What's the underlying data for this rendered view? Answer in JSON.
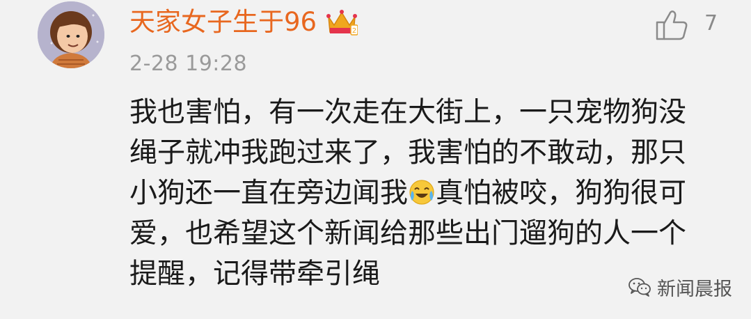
{
  "comment": {
    "username": "天家女子生于96",
    "timestamp": "2-28 19:28",
    "like_count": "7",
    "text_lines": [
      "我也害怕，有一次走在大街上，一只宠物狗没",
      "绳子就冲我跑过来了，我害怕的不敢动，那只",
      "小狗还一直在旁边闻我",
      "真怕被咬，狗狗很可",
      "爱，也希望这个新闻给那些出门遛狗的人一个",
      "提醒，记得带牵引绳"
    ]
  },
  "watermark": {
    "label": "新闻晨报"
  },
  "colors": {
    "username": "#e8671f",
    "crown": "#f0a61e",
    "timestamp": "#9a9a9a",
    "text": "#1a1a1a",
    "background": "#f2f2f2"
  },
  "icons": {
    "avatar": "cartoon-girl-avatar",
    "badge": "crown-level-badge",
    "like": "thumbs-up-icon",
    "emoji": "laugh-cry-emoji",
    "watermark": "wechat-icon"
  }
}
